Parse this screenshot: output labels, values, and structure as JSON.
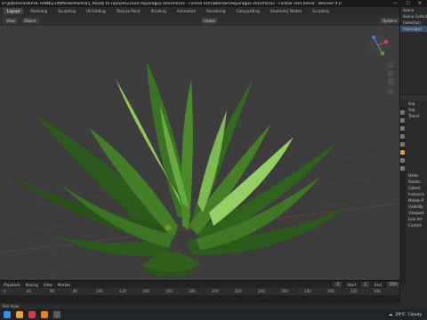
{
  "window": {
    "title": "D:\\Jobs\\Hel\\UKRHL OWN\\Z1M\\ModelPlant\\03_Ready to Upload\\22020 Asparagus densiflorus - Fontail Fern\\Blender\\Asparagus densiflorus - Fontail Fern.blend - Blender 4.0",
    "minimize": "—",
    "maximize": "☐",
    "close": "✕"
  },
  "workspaces": [
    "Layout",
    "Modeling",
    "Sculpting",
    "UV Editing",
    "Texture Paint",
    "Shading",
    "Animation",
    "Rendering",
    "Compositing",
    "Geometry Nodes",
    "Scripting"
  ],
  "viewport_header": {
    "view": "View",
    "object": "Object",
    "orientation": "Global",
    "options": "Options"
  },
  "outliner": {
    "title": "Scene",
    "rows": [
      "Scene Collection",
      "Collection",
      "Asparagus"
    ]
  },
  "properties": {
    "rows": [
      "Asp",
      "Asp",
      "Transf",
      "Delta",
      "Relatio",
      "Collect",
      "Instancin",
      "Motion P",
      "Visibility",
      "Viewport",
      "Line Art",
      "Custom"
    ]
  },
  "timeline": {
    "playback": "Playback",
    "keying": "Keying",
    "view": "View",
    "marker": "Marker",
    "current_frame": "1",
    "start_label": "Start",
    "start": "1",
    "end_label": "End",
    "end": "250",
    "ticks": [
      "0",
      "40",
      "60",
      "80",
      "100",
      "120",
      "140",
      "160",
      "180",
      "200",
      "220",
      "240",
      "260",
      "280",
      "300",
      "320",
      "340"
    ]
  },
  "status": {
    "text": "Pan View"
  },
  "taskbar": {
    "weather": "29°C",
    "condition": "Cloudy"
  },
  "colors": {
    "viewport_bg": "#3d3d3d",
    "leaf_dark": "#2f5a1e",
    "leaf_mid": "#4a8a28",
    "leaf_light": "#8cc85a",
    "active_tab": "#474747"
  }
}
